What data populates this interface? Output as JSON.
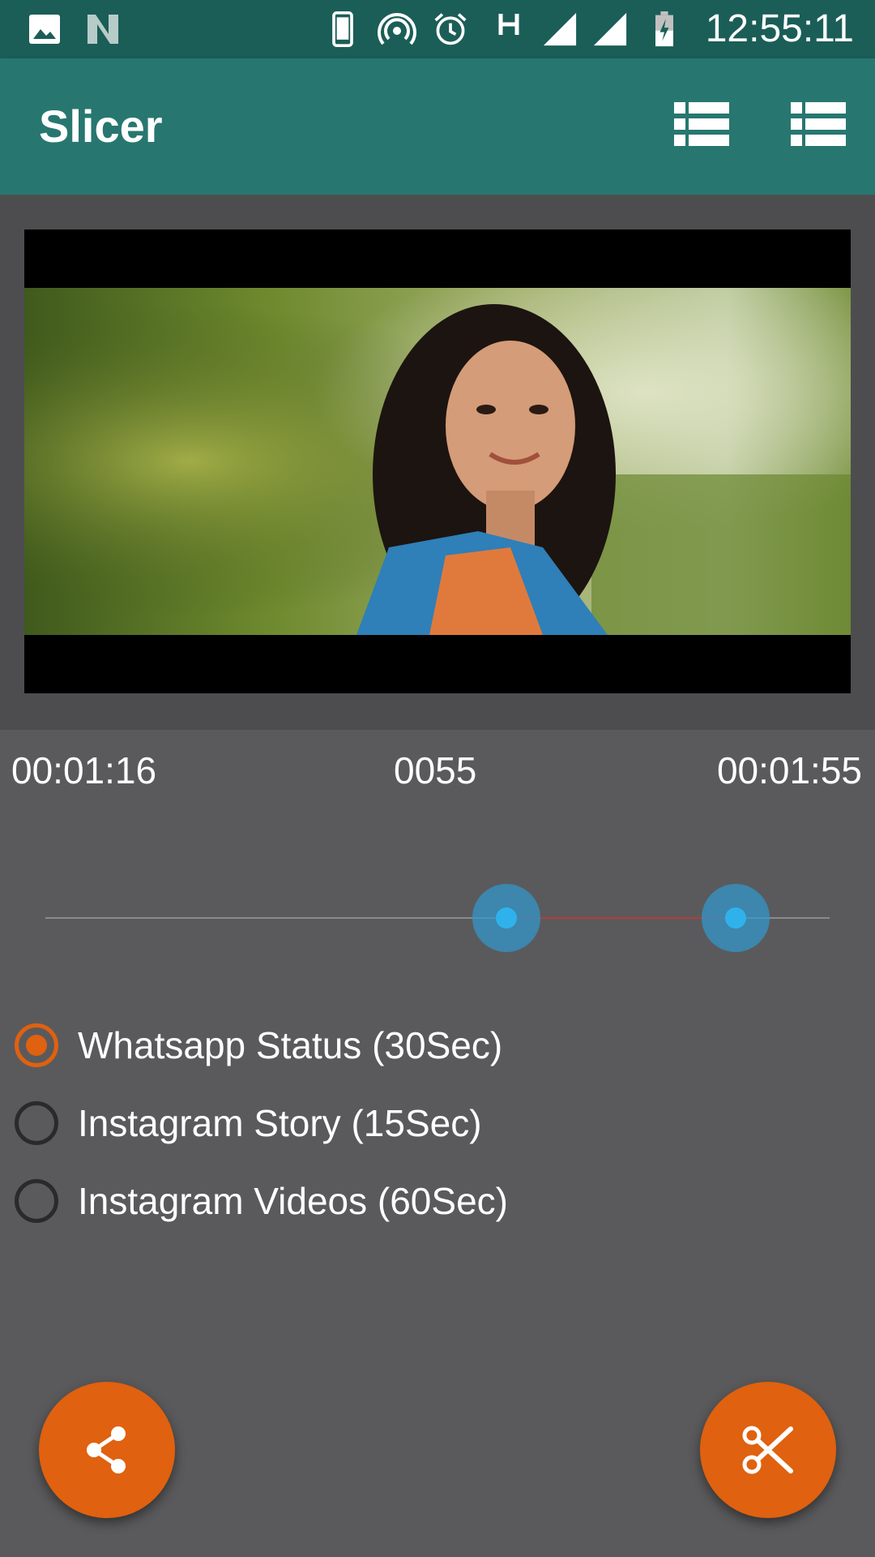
{
  "status_bar": {
    "time": "12:55:11",
    "icons": [
      "image-icon",
      "notification-n-icon",
      "phone-icon",
      "hotspot-icon",
      "alarm-icon",
      "network-h-icon",
      "signal-icon",
      "signal-icon",
      "battery-charging-icon"
    ]
  },
  "app_bar": {
    "title": "Slicer",
    "actions": [
      "list-icon",
      "list-icon"
    ]
  },
  "trim": {
    "start_time": "00:01:16",
    "duration": "0055",
    "end_time": "00:01:55",
    "start_fraction": 0.588,
    "end_fraction": 0.88
  },
  "options": [
    {
      "label": "Whatsapp Status (30Sec)",
      "checked": true
    },
    {
      "label": "Instagram Story (15Sec)",
      "checked": false
    },
    {
      "label": "Instagram Videos (60Sec)",
      "checked": false
    }
  ],
  "colors": {
    "status_bar": "#1b5e57",
    "app_bar": "#277770",
    "background": "#5a5a5c",
    "accent": "#e0610f",
    "slider_thumb": "#2fb2ec",
    "slider_range": "#b43c3c"
  },
  "fabs": {
    "left": "share-icon",
    "right": "scissors-icon"
  }
}
